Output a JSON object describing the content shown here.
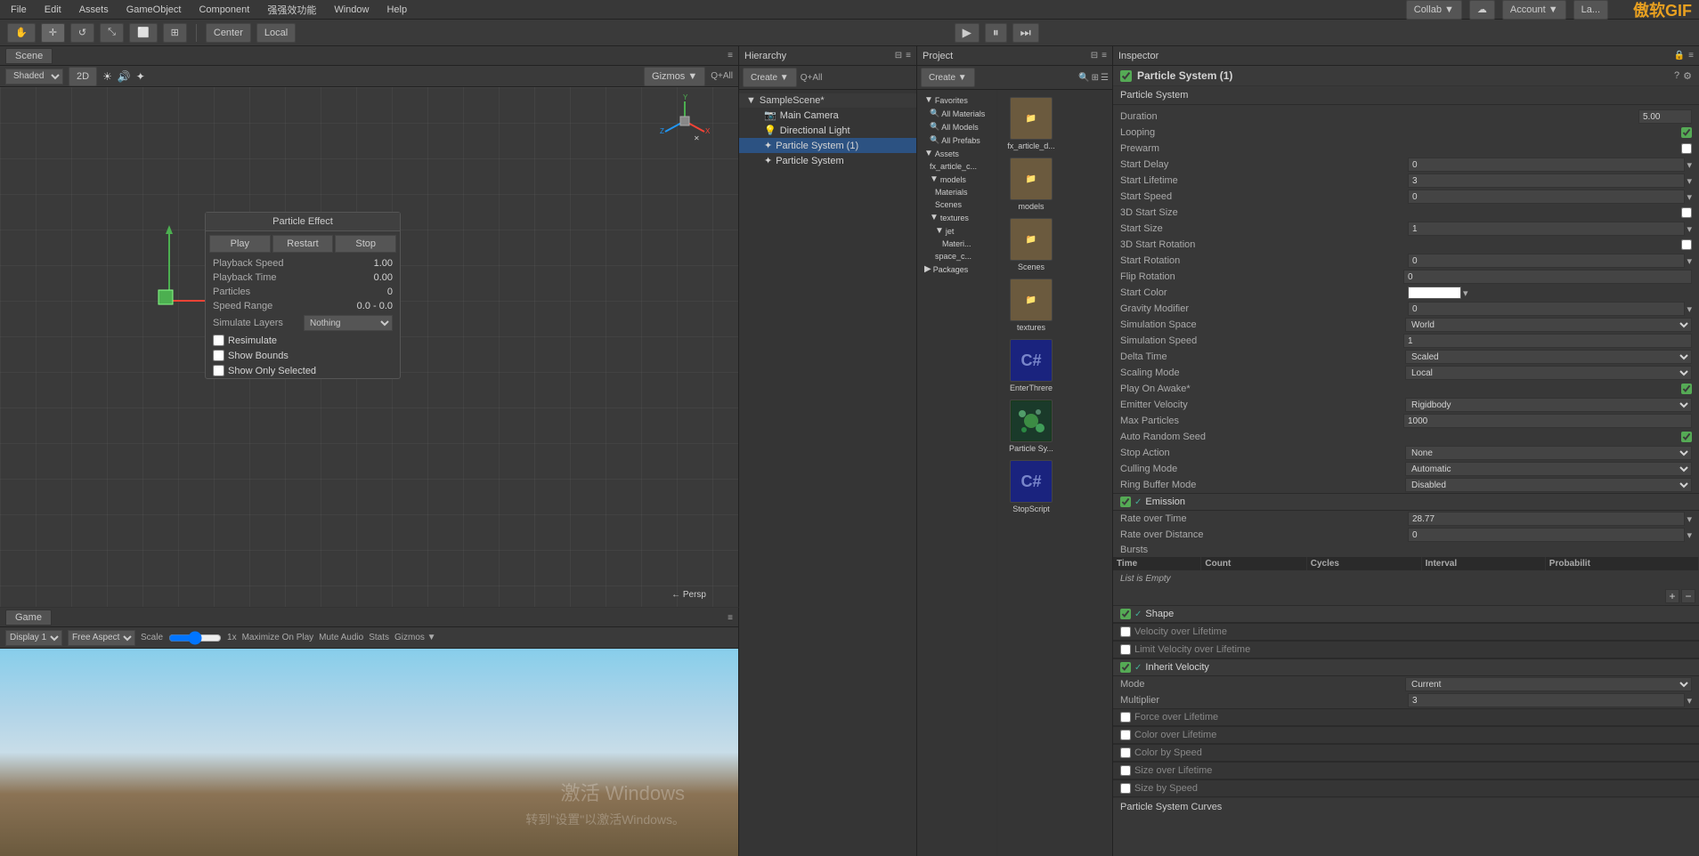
{
  "app": {
    "brand": "傲软GIF"
  },
  "menubar": {
    "items": [
      "File",
      "Edit",
      "Assets",
      "GameObject",
      "Component",
      "强强效功能",
      "Window",
      "Help"
    ]
  },
  "toolbar": {
    "transform_tools": [
      "hand-icon",
      "move-icon",
      "rotate-icon",
      "scale-icon",
      "rect-icon",
      "multi-icon"
    ],
    "pivot_label": "Center",
    "pivot_mode_label": "Local",
    "play_button": "▶",
    "pause_button": "⏸",
    "step_button": "⏭",
    "collab_label": "Collab ▼",
    "cloud_icon": "☁",
    "account_label": "Account ▼",
    "layers_label": "La..."
  },
  "scene_panel": {
    "tab_label": "Scene",
    "toolbar": {
      "shading_mode": "Shaded",
      "is_2d": "2D",
      "gizmos_label": "Gizmos ▼",
      "search_placeholder": "Q+All"
    }
  },
  "game_panel": {
    "tab_label": "Game",
    "toolbar": {
      "display_label": "Display 1",
      "aspect_label": "Free Aspect",
      "scale_label": "Scale",
      "scale_value": "1x",
      "maximize_on_play": "Maximize On Play",
      "mute_audio": "Mute Audio",
      "stats": "Stats",
      "gizmos": "Gizmos ▼"
    }
  },
  "particle_effect": {
    "title": "Particle Effect",
    "play_btn": "Play",
    "restart_btn": "Restart",
    "stop_btn": "Stop",
    "fields": [
      {
        "label": "Playback Speed",
        "value": "1.00"
      },
      {
        "label": "Playback Time",
        "value": "0.00"
      },
      {
        "label": "Particles",
        "value": "0"
      },
      {
        "label": "Speed Range",
        "value": "0.0 - 0.0"
      },
      {
        "label": "Simulate Layers",
        "value": "Nothing"
      }
    ],
    "checkboxes": [
      {
        "label": "Resimulate",
        "checked": false
      },
      {
        "label": "Show Bounds",
        "checked": false
      },
      {
        "label": "Show Only Selected",
        "checked": false
      }
    ]
  },
  "hierarchy": {
    "title": "Hierarchy",
    "create_label": "Create ▼",
    "search_placeholder": "Q+All",
    "scene": "SampleScene*",
    "items": [
      {
        "label": "Main Camera",
        "indent": 1
      },
      {
        "label": "Directional Light",
        "indent": 1
      },
      {
        "label": "Particle System (1)",
        "indent": 1,
        "selected": true
      },
      {
        "label": "Particle System",
        "indent": 1
      }
    ]
  },
  "project": {
    "title": "Project",
    "create_label": "Create ▼",
    "search_placeholder": "",
    "tree": [
      {
        "label": "Favorites",
        "indent": 0
      },
      {
        "label": "All Materials",
        "indent": 1
      },
      {
        "label": "All Models",
        "indent": 1
      },
      {
        "label": "All Prefabs",
        "indent": 1
      },
      {
        "label": "Assets",
        "indent": 0
      },
      {
        "label": "fx_article_c...",
        "indent": 1
      },
      {
        "label": "models",
        "indent": 1
      },
      {
        "label": "Materials",
        "indent": 2
      },
      {
        "label": "Scenes",
        "indent": 2
      },
      {
        "label": "textures",
        "indent": 1
      },
      {
        "label": "jet",
        "indent": 2
      },
      {
        "label": "Materi...",
        "indent": 3
      },
      {
        "label": "space_c...",
        "indent": 2
      },
      {
        "label": "Packages",
        "indent": 0
      }
    ],
    "assets": [
      {
        "label": "fx_article_d...",
        "type": "folder"
      },
      {
        "label": "models",
        "type": "folder"
      },
      {
        "label": "Scenes",
        "type": "folder"
      },
      {
        "label": "textures",
        "type": "folder"
      },
      {
        "label": "EnterThrere",
        "type": "cs"
      },
      {
        "label": "Particle Sy...",
        "type": "ps"
      },
      {
        "label": "StopScript",
        "type": "cs"
      }
    ]
  },
  "inspector": {
    "title": "Inspector",
    "component_name": "Particle System (1)",
    "main_module": {
      "label": "Particle System",
      "fields": [
        {
          "label": "Duration",
          "value": "5.00",
          "type": "input"
        },
        {
          "label": "Looping",
          "value": true,
          "type": "checkbox"
        },
        {
          "label": "Prewarm",
          "value": false,
          "type": "checkbox"
        },
        {
          "label": "Start Delay",
          "value": "0",
          "type": "input-arrow"
        },
        {
          "label": "Start Lifetime",
          "value": "3",
          "type": "input-arrow"
        },
        {
          "label": "Start Speed",
          "value": "0",
          "type": "input-arrow"
        },
        {
          "label": "3D Start Size",
          "value": false,
          "type": "checkbox"
        },
        {
          "label": "Start Size",
          "value": "1",
          "type": "input-arrow"
        },
        {
          "label": "3D Start Rotation",
          "value": false,
          "type": "checkbox"
        },
        {
          "label": "Start Rotation",
          "value": "0",
          "type": "input-arrow"
        },
        {
          "label": "Flip Rotation",
          "value": "0",
          "type": "input"
        },
        {
          "label": "Start Color",
          "value": "",
          "type": "color"
        },
        {
          "label": "Gravity Modifier",
          "value": "0",
          "type": "input-arrow"
        },
        {
          "label": "Simulation Space",
          "value": "World",
          "type": "select"
        },
        {
          "label": "Simulation Speed",
          "value": "1",
          "type": "input"
        },
        {
          "label": "Delta Time",
          "value": "Scaled",
          "type": "select"
        },
        {
          "label": "Scaling Mode",
          "value": "Local",
          "type": "select"
        },
        {
          "label": "Play On Awake*",
          "value": true,
          "type": "checkbox"
        },
        {
          "label": "Emitter Velocity",
          "value": "Rigidbody",
          "type": "select"
        },
        {
          "label": "Max Particles",
          "value": "1000",
          "type": "input"
        },
        {
          "label": "Auto Random Seed",
          "value": true,
          "type": "checkbox"
        },
        {
          "label": "Stop Action",
          "value": "None",
          "type": "select"
        },
        {
          "label": "Culling Mode",
          "value": "Automatic",
          "type": "select"
        },
        {
          "label": "Ring Buffer Mode",
          "value": "Disabled",
          "type": "select"
        }
      ]
    },
    "emission": {
      "label": "Emission",
      "enabled": true,
      "fields": [
        {
          "label": "Rate over Time",
          "value": "28.77",
          "type": "input-arrow"
        },
        {
          "label": "Rate over Distance",
          "value": "0",
          "type": "input-arrow"
        }
      ],
      "bursts": {
        "label": "Bursts",
        "columns": [
          "Time",
          "Count",
          "Cycles",
          "Interval",
          "Probabilit"
        ],
        "empty_text": "List is Empty"
      }
    },
    "modules": [
      {
        "label": "Shape",
        "enabled": true
      },
      {
        "label": "Velocity over Lifetime",
        "enabled": false
      },
      {
        "label": "Limit Velocity over Lifetime",
        "enabled": false
      },
      {
        "label": "Inherit Velocity",
        "enabled": true
      },
      {
        "label": "Mode",
        "value": "Current",
        "type": "select"
      },
      {
        "label": "Multiplier",
        "value": "3",
        "type": "input-arrow"
      },
      {
        "label": "Force over Lifetime",
        "enabled": false
      },
      {
        "label": "Color over Lifetime",
        "enabled": false
      },
      {
        "label": "Color by Speed",
        "enabled": false
      },
      {
        "label": "Size over Lifetime",
        "enabled": false
      },
      {
        "label": "Size by Speed",
        "enabled": false
      }
    ],
    "bottom_label": "Particle System Curves"
  }
}
